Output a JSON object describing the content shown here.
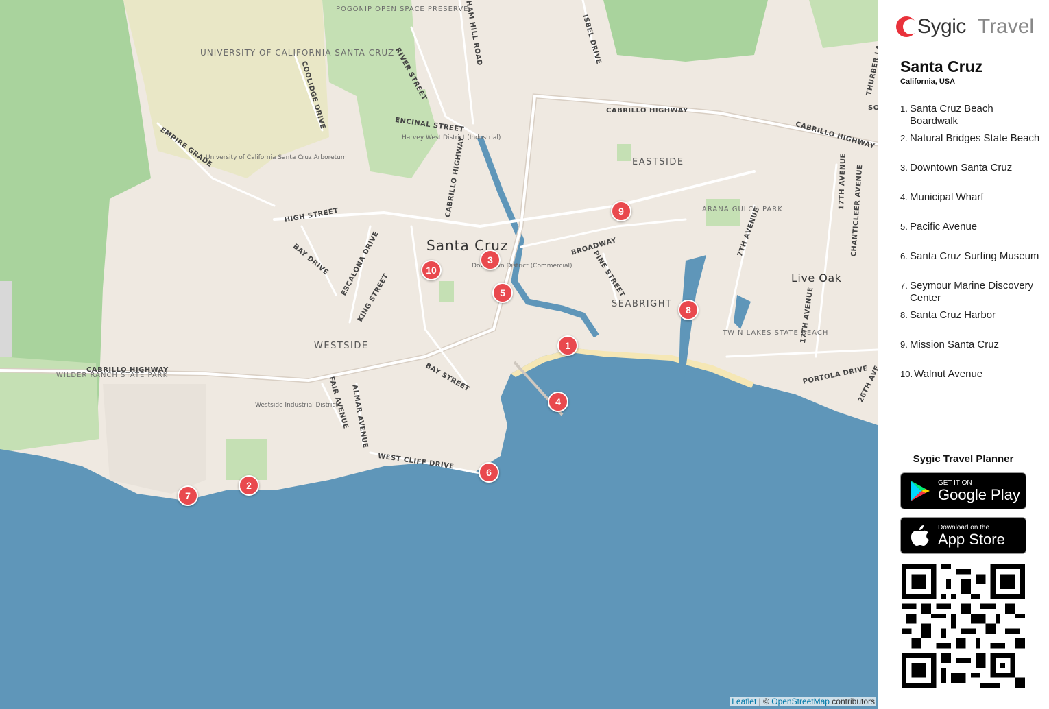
{
  "map": {
    "city_label": "Santa Cruz",
    "town_label": "Live Oak",
    "colors": {
      "ocean": "#5f96b9",
      "land": "#efe9e1",
      "park": "#c5e0b4",
      "forest": "#a9d39d",
      "campus": "#e9e7c6",
      "road": "#ffffff",
      "road_casing": "#cfc8bf",
      "beach": "#f5e7b5",
      "marker": "#e9494e"
    },
    "labels": {
      "university": "UNIVERSITY OF CALIFORNIA SANTA CRUZ",
      "pogonip": "POGONIP OPEN SPACE PRESERVE",
      "arboretum": "University of California Santa Cruz Arboretum",
      "harvey": "Harvey West District (Industrial)",
      "downtown": "Downtown District (Commercial)",
      "westside_industrial": "Westside Industrial District",
      "wilder": "WILDER RANCH STATE PARK",
      "arana": "ARANA GULCH PARK",
      "twin_lakes": "TWIN LAKES STATE BEACH",
      "eastside": "EASTSIDE",
      "westside": "WESTSIDE",
      "seabright": "SEABRIGHT"
    },
    "streets": {
      "river": "RIVER STREET",
      "graham_hill": "HAM HILL ROAD",
      "isbel": "ISBEL DRIVE",
      "coolidge": "COOLIDGE DRIVE",
      "empire_grade": "EMPIRE GRADE",
      "encinal": "ENCINAL STREET",
      "high": "HIGH STREET",
      "bay_drive": "BAY DRIVE",
      "escalona": "ESCALONA DRIVE",
      "king": "KING STREET",
      "bay_street": "BAY STREET",
      "fair": "FAIR AVENUE",
      "almar": "ALMAR AVENUE",
      "west_cliff": "WEST CLIFF DRIVE",
      "cabrillo_west": "CABRILLO HIGHWAY",
      "cabrillo_north": "CABRILLO HIGHWAY",
      "cabrillo_east": "CABRILLO HIGHWAY",
      "cabrillo_hwy_v": "CABRILLO HIGHWAY",
      "broadway": "BROADWAY",
      "pine": "PINE STREET",
      "seventh": "7TH AVENUE",
      "seventeenth_n": "17TH AVENUE",
      "seventeenth_s": "17TH AVENUE",
      "chanticleer": "CHANTICLEER AVENUE",
      "portola": "PORTOLA DRIVE",
      "twentysixth": "26TH AVE",
      "thurber": "THURBER LA",
      "soquel": "SO"
    },
    "markers": [
      {
        "num": "1",
        "name": "Santa Cruz Beach Boardwalk"
      },
      {
        "num": "2",
        "name": "Natural Bridges State Beach"
      },
      {
        "num": "3",
        "name": "Downtown Santa Cruz"
      },
      {
        "num": "4",
        "name": "Municipal Wharf"
      },
      {
        "num": "5",
        "name": "Pacific Avenue"
      },
      {
        "num": "6",
        "name": "Santa Cruz Surfing Museum"
      },
      {
        "num": "7",
        "name": "Seymour Marine Discovery Center"
      },
      {
        "num": "8",
        "name": "Santa Cruz Harbor"
      },
      {
        "num": "9",
        "name": "Mission Santa Cruz"
      },
      {
        "num": "10",
        "name": "Walnut Avenue"
      }
    ],
    "attribution": {
      "leaflet": "Leaflet",
      "sep": " | © ",
      "osm": "OpenStreetMap",
      "contrib": " contributors"
    }
  },
  "panel": {
    "brand": "Sygic",
    "brand_suffix": "Travel",
    "title": "Santa Cruz",
    "subtitle": "California, USA",
    "list": [
      {
        "num": "1.",
        "name": "Santa Cruz Beach Boardwalk"
      },
      {
        "num": "2.",
        "name": "Natural Bridges State Beach"
      },
      {
        "num": "3.",
        "name": "Downtown Santa Cruz"
      },
      {
        "num": "4.",
        "name": "Municipal Wharf"
      },
      {
        "num": "5.",
        "name": "Pacific Avenue"
      },
      {
        "num": "6.",
        "name": "Santa Cruz Surfing Museum"
      },
      {
        "num": "7.",
        "name": "Seymour Marine Discovery Center"
      },
      {
        "num": "8.",
        "name": "Santa Cruz Harbor"
      },
      {
        "num": "9.",
        "name": "Mission Santa Cruz"
      },
      {
        "num": "10.",
        "name": "Walnut Avenue"
      }
    ],
    "planner": "Sygic Travel Planner",
    "google": {
      "small": "GET IT ON",
      "big": "Google Play"
    },
    "apple": {
      "small": "Download on the",
      "big": "App Store"
    }
  }
}
